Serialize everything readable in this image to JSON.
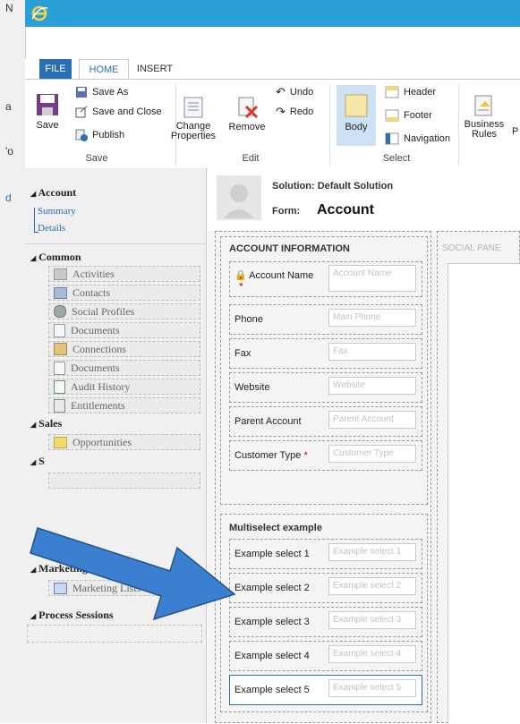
{
  "os_strip": {
    "chars": [
      "N",
      "a",
      "'o",
      "d"
    ]
  },
  "ribbon": {
    "tabs": {
      "file": "FILE",
      "home": "HOME",
      "insert": "INSERT"
    },
    "save_group": {
      "label": "Save",
      "save": "Save",
      "save_as": "Save As",
      "save_and_close": "Save and Close",
      "publish": "Publish"
    },
    "edit_group": {
      "label": "Edit",
      "change_properties_1": "Change",
      "change_properties_2": "Properties",
      "remove": "Remove",
      "undo": "Undo",
      "redo": "Redo"
    },
    "select_group": {
      "label": "Select",
      "body": "Body",
      "header": "Header",
      "footer": "Footer",
      "navigation": "Navigation"
    },
    "business_rules_1": "Business",
    "business_rules_2": "Rules",
    "clipped_p": "P"
  },
  "nav": {
    "account": {
      "title": "Account",
      "summary": "Summary",
      "details": "Details"
    },
    "common": {
      "title": "Common",
      "items": [
        "Activities",
        "Contacts",
        "Social Profiles",
        "Documents",
        "Connections",
        "Documents",
        "Audit History",
        "Entitlements"
      ]
    },
    "sales": {
      "title": "Sales",
      "items": [
        "Opportunities"
      ]
    },
    "service": {
      "title": "S"
    },
    "marketing": {
      "title": "Marketing",
      "items": [
        "Marketing Lists"
      ]
    },
    "process_sessions": {
      "title": "Process Sessions"
    }
  },
  "header": {
    "solution": "Solution: Default Solution",
    "form_label": "Form:",
    "form_name": "Account"
  },
  "account_information": {
    "title": "ACCOUNT INFORMATION",
    "fields": [
      {
        "label": "Account Name",
        "placeholder": "Account Name"
      },
      {
        "label": "Phone",
        "placeholder": "Main Phone"
      },
      {
        "label": "Fax",
        "placeholder": "Fax"
      },
      {
        "label": "Website",
        "placeholder": "Website"
      },
      {
        "label": "Parent Account",
        "placeholder": "Parent Account"
      },
      {
        "label": "Customer Type",
        "placeholder": "Customer Type"
      }
    ],
    "required_mark": "*"
  },
  "multiselect": {
    "title": "Multiselect example",
    "fields": [
      {
        "label": "Example select 1",
        "placeholder": "Example select 1"
      },
      {
        "label": "Example select 2",
        "placeholder": "Example select 2"
      },
      {
        "label": "Example select 3",
        "placeholder": "Example select 3"
      },
      {
        "label": "Example select 4",
        "placeholder": "Example select 4"
      },
      {
        "label": "Example select 5",
        "placeholder": "Example select 5"
      }
    ]
  },
  "social_pane": {
    "title": "SOCIAL PANE"
  },
  "colors": {
    "accent": "#2b6fb3",
    "titlebar": "#2b9fd8",
    "arrow": "#3a7fd0",
    "required": "#d0021b"
  }
}
